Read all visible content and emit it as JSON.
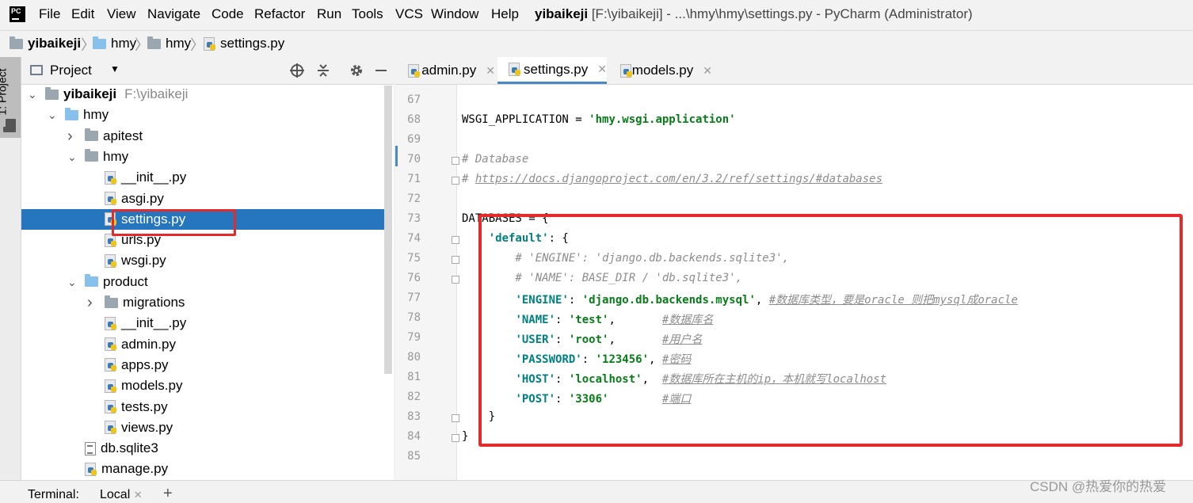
{
  "app": {
    "logo_text": "PC",
    "window_title_project": "yibaikeji",
    "window_title_rest": " [F:\\yibaikeji] - ...\\hmy\\hmy\\settings.py - PyCharm (Administrator)"
  },
  "menu": [
    "File",
    "Edit",
    "View",
    "Navigate",
    "Code",
    "Refactor",
    "Run",
    "Tools",
    "VCS",
    "Window",
    "Help"
  ],
  "breadcrumb": [
    "yibaikeji",
    "hmy",
    "hmy",
    "settings.py"
  ],
  "side_tab": "1: Project",
  "project_panel": {
    "title": "Project",
    "tree": [
      {
        "label": "yibaikeji",
        "extra": "F:\\yibaikeji",
        "type": "folder-gray",
        "depth": 0,
        "expanded": true
      },
      {
        "label": "hmy",
        "type": "folder-blue",
        "depth": 1,
        "expanded": true
      },
      {
        "label": "apitest",
        "type": "folder-gray",
        "depth": 2,
        "expanded": false
      },
      {
        "label": "hmy",
        "type": "folder-gray",
        "depth": 2,
        "expanded": true
      },
      {
        "label": "__init__.py",
        "type": "py",
        "depth": 3
      },
      {
        "label": "asgi.py",
        "type": "py",
        "depth": 3
      },
      {
        "label": "settings.py",
        "type": "py",
        "depth": 3,
        "selected": true
      },
      {
        "label": "urls.py",
        "type": "py",
        "depth": 3
      },
      {
        "label": "wsgi.py",
        "type": "py",
        "depth": 3
      },
      {
        "label": "product",
        "type": "folder-blue",
        "depth": 2,
        "expanded": true
      },
      {
        "label": "migrations",
        "type": "folder-gray",
        "depth": 3,
        "expanded": false
      },
      {
        "label": "__init__.py",
        "type": "py",
        "depth": 3
      },
      {
        "label": "admin.py",
        "type": "py",
        "depth": 3
      },
      {
        "label": "apps.py",
        "type": "py",
        "depth": 3
      },
      {
        "label": "models.py",
        "type": "py",
        "depth": 3
      },
      {
        "label": "tests.py",
        "type": "py",
        "depth": 3
      },
      {
        "label": "views.py",
        "type": "py",
        "depth": 3
      },
      {
        "label": "db.sqlite3",
        "type": "db",
        "depth": 2
      },
      {
        "label": "manage.py",
        "type": "py",
        "depth": 2
      }
    ]
  },
  "editor": {
    "tabs": [
      {
        "label": "admin.py",
        "active": false
      },
      {
        "label": "settings.py",
        "active": true
      },
      {
        "label": "models.py",
        "active": false
      }
    ],
    "lines": [
      {
        "n": "67",
        "parts": []
      },
      {
        "n": "68",
        "parts": [
          {
            "t": "WSGI_APPLICATION = ",
            "c": ""
          },
          {
            "t": "'hmy.wsgi.application'",
            "c": "str"
          }
        ]
      },
      {
        "n": "69",
        "parts": []
      },
      {
        "n": "70",
        "parts": [
          {
            "t": "# Database",
            "c": "cmt"
          }
        ]
      },
      {
        "n": "71",
        "parts": [
          {
            "t": "# ",
            "c": "cmt"
          },
          {
            "t": "https://docs.djangoproject.com/en/3.2/ref/settings/#databases",
            "c": "url"
          }
        ]
      },
      {
        "n": "72",
        "parts": []
      },
      {
        "n": "73",
        "parts": [
          {
            "t": "DATABASES = {",
            "c": ""
          }
        ]
      },
      {
        "n": "74",
        "parts": [
          {
            "t": "    ",
            "c": ""
          },
          {
            "t": "'default'",
            "c": "key"
          },
          {
            "t": ": {",
            "c": ""
          }
        ]
      },
      {
        "n": "75",
        "parts": [
          {
            "t": "        # 'ENGINE': 'django.db.backends.sqlite3',",
            "c": "cmt"
          }
        ]
      },
      {
        "n": "76",
        "parts": [
          {
            "t": "        # 'NAME': BASE_DIR / 'db.sqlite3',",
            "c": "cmt"
          }
        ]
      },
      {
        "n": "77",
        "parts": [
          {
            "t": "        ",
            "c": ""
          },
          {
            "t": "'ENGINE'",
            "c": "key"
          },
          {
            "t": ": ",
            "c": ""
          },
          {
            "t": "'django.db.backends.mysql'",
            "c": "str"
          },
          {
            "t": ", ",
            "c": ""
          },
          {
            "t": "#数据库类型，要是oracle 则把mysql成oracle",
            "c": "url"
          }
        ]
      },
      {
        "n": "78",
        "parts": [
          {
            "t": "        ",
            "c": ""
          },
          {
            "t": "'NAME'",
            "c": "key"
          },
          {
            "t": ": ",
            "c": ""
          },
          {
            "t": "'test'",
            "c": "str"
          },
          {
            "t": ",       ",
            "c": ""
          },
          {
            "t": "#数据库名",
            "c": "url"
          }
        ]
      },
      {
        "n": "79",
        "parts": [
          {
            "t": "        ",
            "c": ""
          },
          {
            "t": "'USER'",
            "c": "key"
          },
          {
            "t": ": ",
            "c": ""
          },
          {
            "t": "'root'",
            "c": "str"
          },
          {
            "t": ",       ",
            "c": ""
          },
          {
            "t": "#用户名",
            "c": "url"
          }
        ]
      },
      {
        "n": "80",
        "parts": [
          {
            "t": "        ",
            "c": ""
          },
          {
            "t": "'PASSWORD'",
            "c": "key"
          },
          {
            "t": ": ",
            "c": ""
          },
          {
            "t": "'123456'",
            "c": "str"
          },
          {
            "t": ", ",
            "c": ""
          },
          {
            "t": "#密码",
            "c": "url"
          }
        ]
      },
      {
        "n": "81",
        "parts": [
          {
            "t": "        ",
            "c": ""
          },
          {
            "t": "'HOST'",
            "c": "key"
          },
          {
            "t": ": ",
            "c": ""
          },
          {
            "t": "'localhost'",
            "c": "str"
          },
          {
            "t": ",  ",
            "c": ""
          },
          {
            "t": "#数据库所在主机的ip，本机就写localhost",
            "c": "url"
          }
        ]
      },
      {
        "n": "82",
        "parts": [
          {
            "t": "        ",
            "c": ""
          },
          {
            "t": "'POST'",
            "c": "key"
          },
          {
            "t": ": ",
            "c": ""
          },
          {
            "t": "'3306'",
            "c": "str"
          },
          {
            "t": "        ",
            "c": ""
          },
          {
            "t": "#端口",
            "c": "url"
          }
        ]
      },
      {
        "n": "83",
        "parts": [
          {
            "t": "    }",
            "c": ""
          }
        ]
      },
      {
        "n": "84",
        "parts": [
          {
            "t": "}",
            "c": ""
          }
        ]
      },
      {
        "n": "85",
        "parts": []
      }
    ]
  },
  "bottom": {
    "terminal_label": "Terminal:",
    "session_tab": "Local",
    "add_symbol": "+"
  },
  "watermark": "CSDN @热爱你的热爱",
  "colors": {
    "selection": "#2675bf",
    "highlight_box": "#e32b2b",
    "string": "#067d17",
    "key": "#008080",
    "comment": "#8c8c8c"
  }
}
